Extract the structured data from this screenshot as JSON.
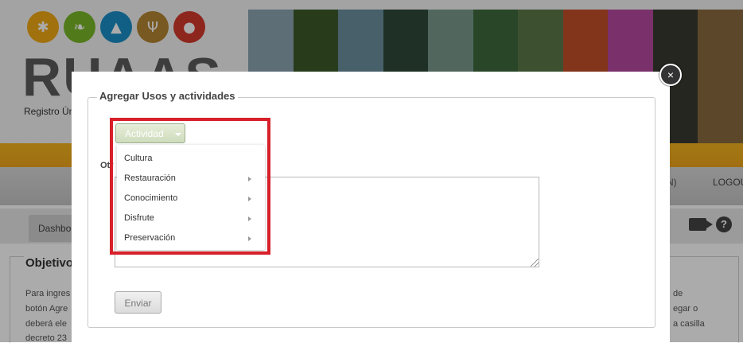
{
  "brand": {
    "name": "RUAAS",
    "subtitle": "Registro Ún",
    "icon_colors": [
      "#f0a915",
      "#7ab829",
      "#1a8ec7",
      "#b48532",
      "#d33a2c"
    ]
  },
  "nav": {
    "partial_item": "N)",
    "logout_label": "LOGOUT"
  },
  "tabs": {
    "dashboard_label": "Dashbo"
  },
  "objetivo": {
    "title": "Objetivo",
    "left_lines": [
      "Para ingres",
      "botón Agre",
      "deberá ele",
      "decreto 23"
    ],
    "right_lines": [
      "de",
      "egar o",
      "a casilla"
    ]
  },
  "modal": {
    "legend": "Agregar Usos y actividades",
    "otros_label": "Otr",
    "actividad_button": "Actividad",
    "enviar_button": "Enviar",
    "close_label": "×",
    "menu_items": [
      {
        "label": "Cultura",
        "has_submenu": false
      },
      {
        "label": "Restauración",
        "has_submenu": true
      },
      {
        "label": "Conocimiento",
        "has_submenu": true
      },
      {
        "label": "Disfrute",
        "has_submenu": true
      },
      {
        "label": "Preservación",
        "has_submenu": true
      }
    ]
  },
  "colors": {
    "accent_yellow": "#f3b51f",
    "highlight_red": "#d7202a",
    "actividad_green": "#cfdcbd"
  }
}
